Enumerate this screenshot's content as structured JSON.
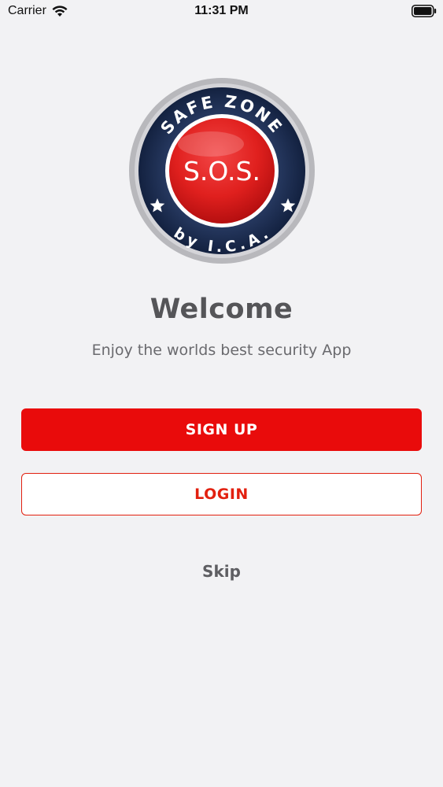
{
  "status_bar": {
    "carrier": "Carrier",
    "time": "11:31 PM"
  },
  "logo": {
    "top_arc_text": "SAFE ZONE",
    "center_text": "S.O.S.",
    "bottom_arc_text": "by I.C.A."
  },
  "welcome": {
    "title": "Welcome",
    "subtitle": "Enjoy the worlds best security App"
  },
  "buttons": {
    "signup_label": "SIGN UP",
    "login_label": "LOGIN",
    "skip_label": "Skip"
  },
  "colors": {
    "accent_red": "#e90b0b",
    "background": "#f2f2f4",
    "logo_navy": "#0f1d3c"
  },
  "icons": {
    "wifi": "wifi-icon",
    "battery": "battery-icon"
  }
}
